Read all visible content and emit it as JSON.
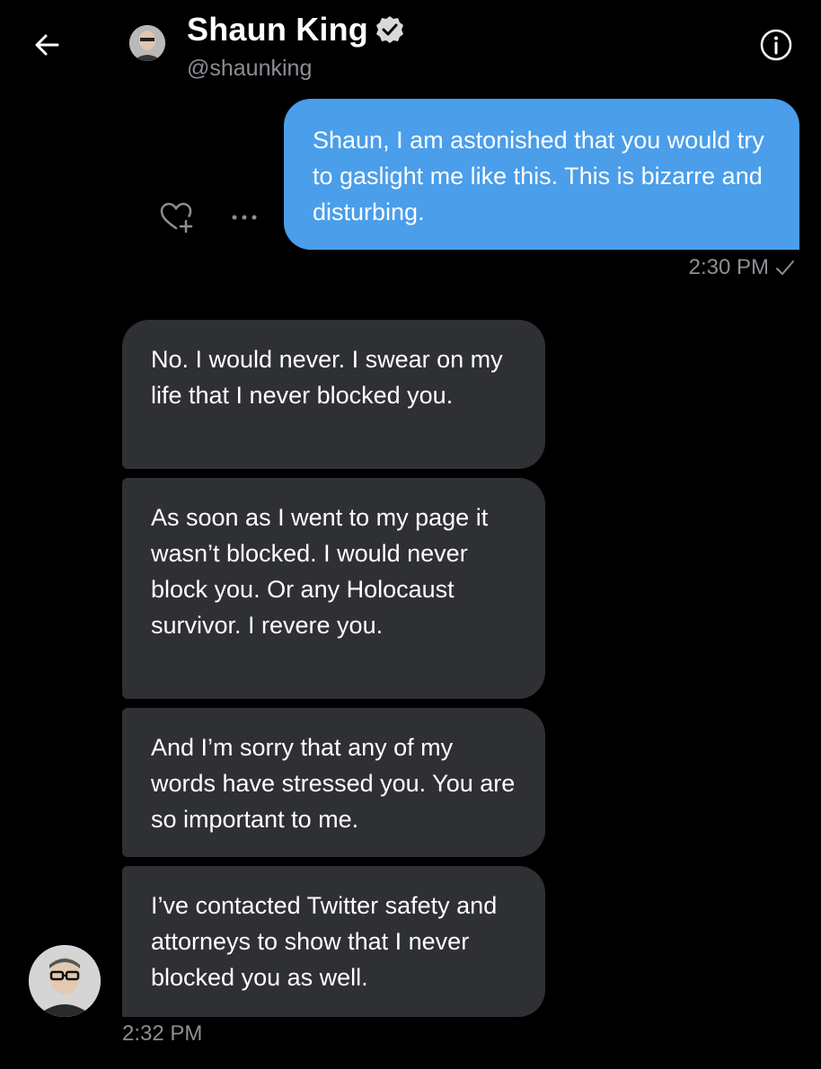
{
  "header": {
    "back_icon": "arrow-left-icon",
    "name": "Shaun King",
    "verified_icon": "verified-badge-icon",
    "handle": "@shaunking",
    "info_icon": "info-icon"
  },
  "colors": {
    "background": "#000000",
    "sent_bubble": "#4a9eea",
    "received_bubble": "#2e3033",
    "muted_text": "#8b8f94"
  },
  "messages": {
    "sent": {
      "text": "Shaun, I am astonished that you would try to gaslight me like this. This is bizarre and disturbing.",
      "time": "2:30 PM",
      "status_icon": "checkmark-icon",
      "actions": {
        "react_icon": "heart-plus-icon",
        "more_icon": "more-dots-icon"
      }
    },
    "received": [
      {
        "text": "No. I would never. I swear on my life that I never blocked you."
      },
      {
        "text": "As soon as I went to my page it wasn’t blocked. I would never block you. Or any Holocaust survivor. I revere you."
      },
      {
        "text": "And I’m sorry that any of my words have stressed you. You are so important to me."
      },
      {
        "text": "I’ve contacted Twitter safety and attorneys to show that I never blocked you as well."
      }
    ],
    "received_time": "2:32 PM"
  }
}
